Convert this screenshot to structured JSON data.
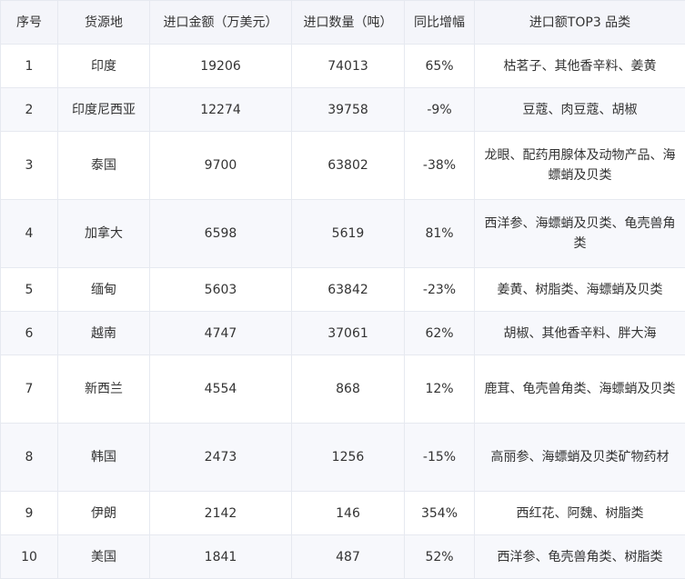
{
  "headers": [
    "序号",
    "货源地",
    "进口金额（万美元）",
    "进口数量（吨）",
    "同比增幅",
    "进口额TOP3 品类"
  ],
  "rows": [
    {
      "no": "1",
      "origin": "印度",
      "amount": "19206",
      "qty": "74013",
      "growth": "65%",
      "top3": "枯茗子、其他香辛料、姜黄"
    },
    {
      "no": "2",
      "origin": "印度尼西亚",
      "amount": "12274",
      "qty": "39758",
      "growth": "-9%",
      "top3": "豆蔻、肉豆蔻、胡椒"
    },
    {
      "no": "3",
      "origin": "泰国",
      "amount": "9700",
      "qty": "63802",
      "growth": "-38%",
      "top3": "龙眼、配药用腺体及动物产品、海螵蛸及贝类"
    },
    {
      "no": "4",
      "origin": "加拿大",
      "amount": "6598",
      "qty": "5619",
      "growth": "81%",
      "top3": "西洋参、海螵蛸及贝类、龟壳兽角类"
    },
    {
      "no": "5",
      "origin": "缅甸",
      "amount": "5603",
      "qty": "63842",
      "growth": "-23%",
      "top3": "姜黄、树脂类、海螵蛸及贝类"
    },
    {
      "no": "6",
      "origin": "越南",
      "amount": "4747",
      "qty": "37061",
      "growth": "62%",
      "top3": "胡椒、其他香辛料、胖大海"
    },
    {
      "no": "7",
      "origin": "新西兰",
      "amount": "4554",
      "qty": "868",
      "growth": "12%",
      "top3": "鹿茸、龟壳兽角类、海螵蛸及贝类"
    },
    {
      "no": "8",
      "origin": "韩国",
      "amount": "2473",
      "qty": "1256",
      "growth": "-15%",
      "top3": "高丽参、海螵蛸及贝类矿物药材"
    },
    {
      "no": "9",
      "origin": "伊朗",
      "amount": "2142",
      "qty": "146",
      "growth": "354%",
      "top3": "西红花、阿魏、树脂类"
    },
    {
      "no": "10",
      "origin": "美国",
      "amount": "1841",
      "qty": "487",
      "growth": "52%",
      "top3": "西洋参、龟壳兽角类、树脂类"
    }
  ]
}
